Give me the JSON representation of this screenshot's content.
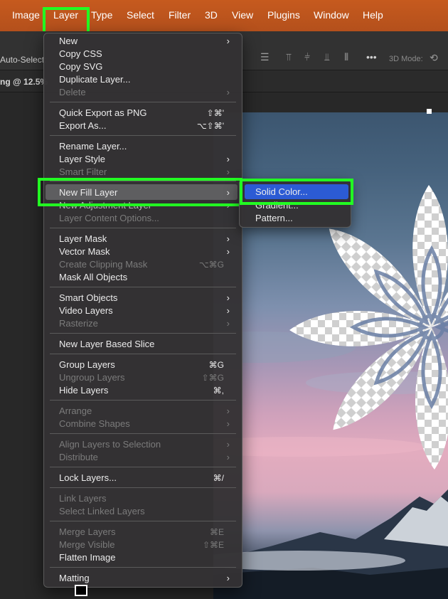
{
  "menubar": {
    "items": [
      "Image",
      "Layer",
      "Type",
      "Select",
      "Filter",
      "3D",
      "View",
      "Plugins",
      "Window",
      "Help"
    ]
  },
  "options_bar": {
    "auto_select_label": "Auto-Select:",
    "mode_3d_label": "3D Mode:",
    "more_glyph": "•••"
  },
  "document_tab": {
    "label": "ng @ 12.5%"
  },
  "layer_menu": {
    "items": [
      {
        "label": "New",
        "submenu": true,
        "enabled": true
      },
      {
        "label": "Copy CSS",
        "enabled": true
      },
      {
        "label": "Copy SVG",
        "enabled": true
      },
      {
        "label": "Duplicate Layer...",
        "enabled": true
      },
      {
        "label": "Delete",
        "submenu": true,
        "enabled": false
      },
      {
        "label": "Quick Export as PNG",
        "shortcut": "⇧⌘'",
        "enabled": true
      },
      {
        "label": "Export As...",
        "shortcut": "⌥⇧⌘'",
        "enabled": true
      },
      {
        "label": "Rename Layer...",
        "enabled": true
      },
      {
        "label": "Layer Style",
        "submenu": true,
        "enabled": true
      },
      {
        "label": "Smart Filter",
        "submenu": true,
        "enabled": false
      },
      {
        "label": "New Fill Layer",
        "submenu": true,
        "enabled": true,
        "highlighted": true
      },
      {
        "label": "New Adjustment Layer",
        "submenu": true,
        "enabled": true
      },
      {
        "label": "Layer Content Options...",
        "enabled": false
      },
      {
        "label": "Layer Mask",
        "submenu": true,
        "enabled": true
      },
      {
        "label": "Vector Mask",
        "submenu": true,
        "enabled": true
      },
      {
        "label": "Create Clipping Mask",
        "shortcut": "⌥⌘G",
        "enabled": false
      },
      {
        "label": "Mask All Objects",
        "enabled": true
      },
      {
        "label": "Smart Objects",
        "submenu": true,
        "enabled": true
      },
      {
        "label": "Video Layers",
        "submenu": true,
        "enabled": true
      },
      {
        "label": "Rasterize",
        "submenu": true,
        "enabled": false
      },
      {
        "label": "New Layer Based Slice",
        "enabled": true
      },
      {
        "label": "Group Layers",
        "shortcut": "⌘G",
        "enabled": true
      },
      {
        "label": "Ungroup Layers",
        "shortcut": "⇧⌘G",
        "enabled": false
      },
      {
        "label": "Hide Layers",
        "shortcut": "⌘,",
        "enabled": true
      },
      {
        "label": "Arrange",
        "submenu": true,
        "enabled": false
      },
      {
        "label": "Combine Shapes",
        "submenu": true,
        "enabled": false
      },
      {
        "label": "Align Layers to Selection",
        "submenu": true,
        "enabled": false
      },
      {
        "label": "Distribute",
        "submenu": true,
        "enabled": false
      },
      {
        "label": "Lock Layers...",
        "shortcut": "⌘/",
        "enabled": true
      },
      {
        "label": "Link Layers",
        "enabled": false
      },
      {
        "label": "Select Linked Layers",
        "enabled": false
      },
      {
        "label": "Merge Layers",
        "shortcut": "⌘E",
        "enabled": false
      },
      {
        "label": "Merge Visible",
        "shortcut": "⇧⌘E",
        "enabled": false
      },
      {
        "label": "Flatten Image",
        "enabled": true
      },
      {
        "label": "Matting",
        "submenu": true,
        "enabled": true
      }
    ]
  },
  "fill_submenu": {
    "items": [
      {
        "label": "Solid Color...",
        "highlighted": true
      },
      {
        "label": "Gradient..."
      },
      {
        "label": "Pattern..."
      }
    ]
  },
  "colors": {
    "menubar": "#b4501c",
    "highlight_box": "#22ff22",
    "submenu_selection": "#2c5bd4"
  }
}
